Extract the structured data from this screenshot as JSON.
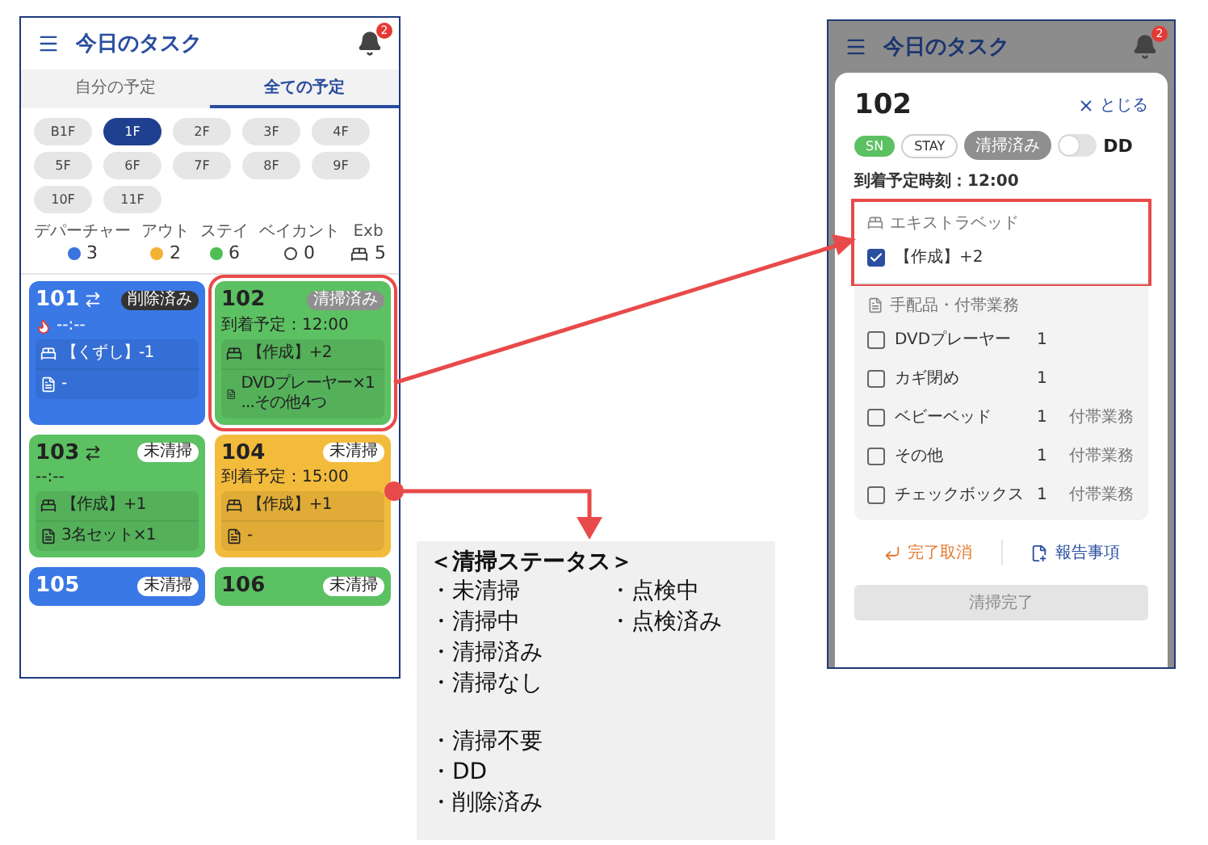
{
  "task_screen": {
    "title": "今日のタスク",
    "notification_count": "2",
    "tabs": [
      {
        "label": "自分の予定",
        "selected": false
      },
      {
        "label": "全ての予定",
        "selected": true
      }
    ],
    "floors": [
      {
        "label": "B1F",
        "selected": false
      },
      {
        "label": "1F",
        "selected": true
      },
      {
        "label": "2F",
        "selected": false
      },
      {
        "label": "3F",
        "selected": false
      },
      {
        "label": "4F",
        "selected": false
      },
      {
        "label": "5F",
        "selected": false
      },
      {
        "label": "6F",
        "selected": false
      },
      {
        "label": "7F",
        "selected": false
      },
      {
        "label": "8F",
        "selected": false
      },
      {
        "label": "9F",
        "selected": false
      },
      {
        "label": "10F",
        "selected": false
      },
      {
        "label": "11F",
        "selected": false
      }
    ],
    "stats": [
      {
        "label": "デパーチャー",
        "kind": "dot",
        "color": "#3b73e0",
        "count": "3"
      },
      {
        "label": "アウト",
        "kind": "dot",
        "color": "#f2b233",
        "count": "2"
      },
      {
        "label": "ステイ",
        "kind": "dot",
        "color": "#4fbf55",
        "count": "6"
      },
      {
        "label": "ベイカント",
        "kind": "ring",
        "count": "0"
      },
      {
        "label": "Exb",
        "kind": "bed",
        "count": "5"
      }
    ],
    "rooms": [
      {
        "number": "101",
        "swap": true,
        "status": "削除済み",
        "kind": "dark",
        "color": "#3a78e6",
        "urgent": true,
        "line": "--:--",
        "highlighted": false,
        "items": [
          {
            "kind": "bed",
            "text": "【くずし】-1"
          },
          {
            "kind": "doc",
            "text": "-"
          }
        ]
      },
      {
        "number": "102",
        "status": "清掃済み",
        "kind": "muted",
        "color": "#5cc162",
        "line": "到着予定：12:00",
        "highlighted": true,
        "items": [
          {
            "kind": "bed",
            "text": "【作成】+2"
          },
          {
            "kind": "doc",
            "text": "DVDプレーヤー×1 ...その他4つ"
          }
        ]
      },
      {
        "number": "103",
        "swap": true,
        "status": "未清掃",
        "kind": "white",
        "color": "#5cc162",
        "line": "--:--",
        "highlighted": false,
        "items": [
          {
            "kind": "bed",
            "text": "【作成】+1"
          },
          {
            "kind": "doc",
            "text": "3名セット×1"
          }
        ]
      },
      {
        "number": "104",
        "status": "未清掃",
        "kind": "white",
        "color": "#f3bb3c",
        "line": "到着予定：15:00",
        "highlighted": false,
        "items": [
          {
            "kind": "bed",
            "text": "【作成】+1"
          },
          {
            "kind": "doc",
            "text": "-"
          }
        ]
      },
      {
        "number": "105",
        "status": "未清掃",
        "kind": "white",
        "color": "#3a78e6",
        "highlighted": false
      },
      {
        "number": "106",
        "status": "未清掃",
        "kind": "white",
        "color": "#5cc162",
        "highlighted": false
      }
    ]
  },
  "detail_screen": {
    "title": "今日のタスク",
    "notification_count": "2",
    "room": "102",
    "close": "とじる",
    "tags": [
      {
        "kind": "sn",
        "label": "SN"
      },
      {
        "kind": "outline",
        "label": "STAY"
      },
      {
        "kind": "muted",
        "label": "清掃済み"
      }
    ],
    "dd": {
      "label": "DD",
      "on": false
    },
    "arrival": "到着予定時刻：12:00",
    "extra_bed": {
      "title": "エキストラベッド",
      "highlighted": true,
      "item": {
        "label": "【作成】+2",
        "checked": true
      }
    },
    "supplies": {
      "title": "手配品・付帯業務",
      "items": [
        {
          "name": "DVDプレーヤー",
          "qty": "1",
          "checked": false
        },
        {
          "name": "カギ閉め",
          "qty": "1",
          "checked": false
        },
        {
          "name": "ベビーベッド",
          "qty": "1",
          "tag": "付帯業務",
          "checked": false
        },
        {
          "name": "その他",
          "qty": "1",
          "tag": "付帯業務",
          "checked": false
        },
        {
          "name": "チェックボックス",
          "qty": "1",
          "tag": "付帯業務",
          "checked": false
        }
      ]
    },
    "actions": [
      {
        "kind": "undo",
        "label": "完了取消"
      },
      {
        "kind": "report",
        "label": "報告事項"
      }
    ],
    "submit": {
      "label": "清掃完了",
      "disabled": true
    }
  },
  "status_note": {
    "title": "＜清掃ステータス＞",
    "left_groups": [
      [
        "・未清掃",
        "・清掃中",
        "・清掃済み",
        "・清掃なし"
      ],
      [
        "・清掃不要",
        "・DD",
        "・削除済み"
      ]
    ],
    "right_items": [
      "・点検中",
      "・点検済み"
    ]
  }
}
